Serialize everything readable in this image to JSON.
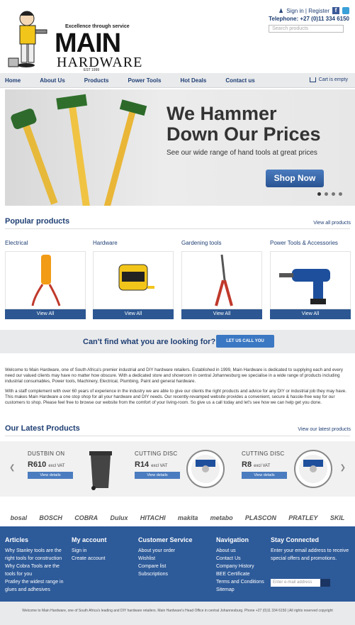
{
  "header": {
    "tagline": "Excellence through service",
    "logo_main": "MAIN",
    "logo_sub": "HARDWARE",
    "logo_est": "EST 1999",
    "signin": "Sign in | Register",
    "phone": "Telephone: +27 (0)11 334 6150",
    "search_placeholder": "Search products"
  },
  "nav": {
    "items": [
      "Home",
      "About Us",
      "Products",
      "Power Tools",
      "Hot Deals",
      "Contact us"
    ],
    "cart": "Cart is empty"
  },
  "banner": {
    "title_line1": "We Hammer",
    "title_line2": "Down Our Prices",
    "subtitle": "See our wide range of hand tools at great prices",
    "button": "Shop Now"
  },
  "popular": {
    "title": "Popular products",
    "view_all": "View all products",
    "categories": [
      {
        "label": "Electrical",
        "button": "View All"
      },
      {
        "label": "Hardware",
        "button": "View All"
      },
      {
        "label": "Gardening tools",
        "button": "View All"
      },
      {
        "label": "Power Tools & Accessories",
        "button": "View All"
      }
    ]
  },
  "cta": {
    "text": "Can't find what you are looking for?",
    "button": "LET US CALL YOU"
  },
  "welcome": {
    "p1": "Welcome to Main Hardware, one of South Africa's premier industrial and DIY hardware retailers. Established in 1999, Main Hardware is dedicated to supplying each and every need our valued clients may have no matter how obscure. With a dedicated store and showroom in central Johannesburg we specialise in a wide range of products including industrial consumables, Power tools, Machinery, Electrical, Plumbing, Paint and general hardware.",
    "p2": "With a staff complement with over 60 years of experience in the industry we are able to give our clients the right products and advice for any DIY or industrial job they may have. This makes Main Hardware a one stop shop for all your hardware and DIY needs. Our recently-revamped website provides a convenient, secure & hassle-free way for our customers to shop. Please feel free to browse our website from the comfort of your living-room. So give us a call today and let's see how we can help get you done."
  },
  "latest": {
    "title": "Our Latest Products",
    "view_all": "View our latest products",
    "products": [
      {
        "name": "DUSTBIN ON",
        "price": "R610",
        "vat": "excl VAT",
        "button": "View details"
      },
      {
        "name": "CUTTING DISC",
        "price": "R14",
        "vat": "excl VAT",
        "button": "View details"
      },
      {
        "name": "CUTTING DISC",
        "price": "R8",
        "vat": "excl VAT",
        "button": "View details"
      }
    ]
  },
  "brands": [
    "bosal",
    "BOSCH",
    "COBRA",
    "Dulux",
    "HITACHI",
    "makita",
    "metabo",
    "PLASCON",
    "PRATLEY",
    "SKIL"
  ],
  "footer": {
    "columns": [
      {
        "heading": "Articles",
        "links": [
          "Why Stanley tools are the right tools for construction",
          "Why Cobra Tools are the tools for you",
          "Pratley the widest range in glues and adhesives"
        ]
      },
      {
        "heading": "My account",
        "links": [
          "Sign in",
          "Create account"
        ]
      },
      {
        "heading": "Customer Service",
        "links": [
          "About your order",
          "Wishlist",
          "Compare list",
          "Subscriptions"
        ]
      },
      {
        "heading": "Navigation",
        "links": [
          "About us",
          "Contact Us",
          "Company History",
          "BEE Certificate",
          "Terms and Conditions",
          "Sitemap"
        ]
      }
    ],
    "stay": {
      "heading": "Stay Connected",
      "text": "Enter your email address to receive special offers and promotions.",
      "placeholder": "Enter e-mail address"
    },
    "bottom": "Welcome to Main Hardware, one of South Africa's leading and DIY hardware retailers. Main Hardware's Head Office in central Johannesburg. Phone +27 (0)11 334 6150 | All rights reserved copyright"
  }
}
